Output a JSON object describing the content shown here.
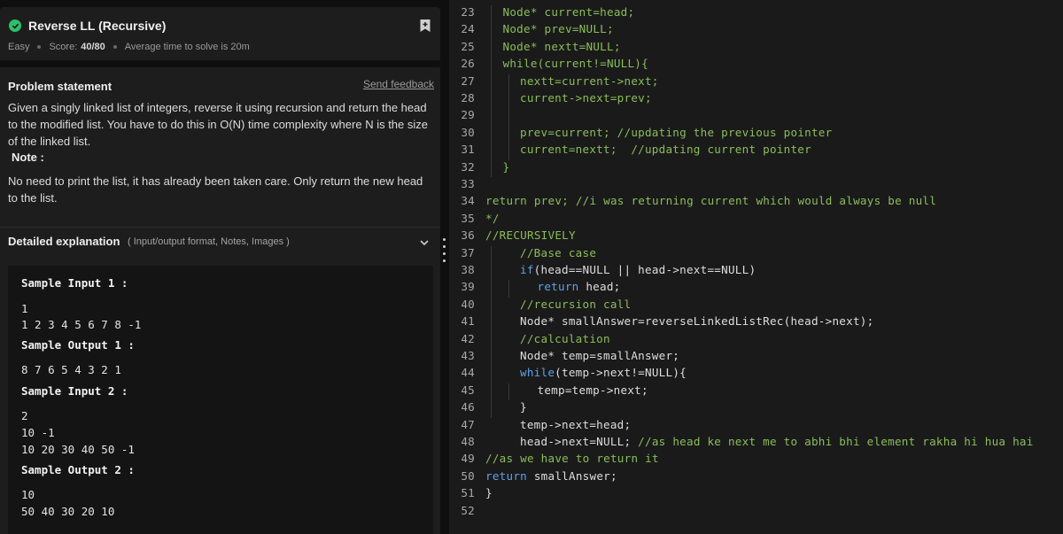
{
  "problem": {
    "title": "Reverse LL (Recursive)",
    "difficulty": "Easy",
    "score_label": "Score:",
    "score_value": "40/80",
    "avg_time": "Average time to solve is 20m"
  },
  "statement": {
    "heading": "Problem statement",
    "feedback_link": "Send feedback",
    "text": "Given a singly linked list of integers, reverse it using recursion and return the head to the modified list. You have to do this in O(N) time complexity where N is the size of the linked list.",
    "note_label": "Note :",
    "note_text": "No need to print the list, it has already been taken care. Only return the new head to the list."
  },
  "detail": {
    "title": "Detailed explanation",
    "subtitle": "( Input/output format, Notes, Images )"
  },
  "samples": {
    "input1_label": "Sample Input 1 :",
    "input1_lines": [
      "1",
      "1 2 3 4 5 6 7 8 -1"
    ],
    "output1_label": "Sample Output 1 :",
    "output1_lines": [
      "8 7 6 5 4 3 2 1"
    ],
    "input2_label": "Sample Input 2 :",
    "input2_lines": [
      "2",
      "10 -1",
      "10 20 30 40 50 -1"
    ],
    "output2_label": "Sample Output 2 :",
    "output2_lines": [
      "10",
      "50 40 30 20 10"
    ]
  },
  "colors": {
    "success": "#2ebd6b",
    "comment_green": "#8bbd5a",
    "keyword_blue": "#5fa0e8"
  },
  "icons": [
    "check-circle-icon",
    "bookmark-icon",
    "chevron-down-icon",
    "drag-handle-icon"
  ],
  "code_lines": [
    {
      "n": "23",
      "indent": 1,
      "tokens": [
        [
          "g",
          "Node* current=head;"
        ]
      ]
    },
    {
      "n": "24",
      "indent": 1,
      "tokens": [
        [
          "g",
          "Node* prev=NULL;"
        ]
      ]
    },
    {
      "n": "25",
      "indent": 1,
      "tokens": [
        [
          "g",
          "Node* nextt=NULL;"
        ]
      ]
    },
    {
      "n": "26",
      "indent": 1,
      "tokens": [
        [
          "g",
          "while(current!=NULL){"
        ]
      ]
    },
    {
      "n": "27",
      "indent": 2,
      "tokens": [
        [
          "g",
          "nextt=current->next;"
        ]
      ]
    },
    {
      "n": "28",
      "indent": 2,
      "tokens": [
        [
          "g",
          "current->next=prev;"
        ]
      ]
    },
    {
      "n": "29",
      "indent": 0,
      "tokens": []
    },
    {
      "n": "30",
      "indent": 2,
      "tokens": [
        [
          "g",
          "prev=current; //updating the previous pointer"
        ]
      ]
    },
    {
      "n": "31",
      "indent": 2,
      "tokens": [
        [
          "g",
          "current=nextt;  //updating current pointer"
        ]
      ]
    },
    {
      "n": "32",
      "indent": 1,
      "tokens": [
        [
          "g",
          "}"
        ]
      ]
    },
    {
      "n": "33",
      "indent": 0,
      "tokens": []
    },
    {
      "n": "34",
      "indent": 0,
      "tokens": [
        [
          "g",
          "return prev; //i was returning current which would always be null"
        ]
      ]
    },
    {
      "n": "35",
      "indent": 0,
      "tokens": [
        [
          "g",
          "*/"
        ]
      ]
    },
    {
      "n": "36",
      "indent": 0,
      "tokens": [
        [
          "g",
          "//RECURSIVELY"
        ]
      ]
    },
    {
      "n": "37",
      "indent": 2,
      "tokens": [
        [
          "g",
          "//Base case"
        ]
      ]
    },
    {
      "n": "38",
      "indent": 2,
      "tokens": [
        [
          "b",
          "if"
        ],
        [
          "w",
          "(head==NULL || head->next==NULL)"
        ]
      ]
    },
    {
      "n": "39",
      "indent": 3,
      "tokens": [
        [
          "b",
          "return"
        ],
        [
          "w",
          " head;"
        ]
      ]
    },
    {
      "n": "40",
      "indent": 2,
      "tokens": [
        [
          "g",
          "//recursion call"
        ]
      ]
    },
    {
      "n": "41",
      "indent": 2,
      "tokens": [
        [
          "w",
          "Node* smallAnswer=reverseLinkedListRec(head->next);"
        ]
      ]
    },
    {
      "n": "42",
      "indent": 2,
      "tokens": [
        [
          "g",
          "//calculation"
        ]
      ]
    },
    {
      "n": "43",
      "indent": 2,
      "tokens": [
        [
          "w",
          "Node* temp=smallAnswer;"
        ]
      ]
    },
    {
      "n": "44",
      "indent": 2,
      "tokens": [
        [
          "b",
          "while"
        ],
        [
          "w",
          "(temp->next!=NULL){"
        ]
      ]
    },
    {
      "n": "45",
      "indent": 3,
      "tokens": [
        [
          "w",
          "temp=temp->next;"
        ]
      ]
    },
    {
      "n": "46",
      "indent": 2,
      "tokens": [
        [
          "w",
          "}"
        ]
      ]
    },
    {
      "n": "47",
      "indent": 2,
      "tokens": [
        [
          "w",
          "temp->next=head;"
        ]
      ]
    },
    {
      "n": "48",
      "indent": 2,
      "tokens": [
        [
          "w",
          "head->next=NULL; "
        ],
        [
          "g",
          "//as head ke next me to abhi bhi element rakha hi hua hai"
        ]
      ]
    },
    {
      "n": "49",
      "indent": 0,
      "tokens": [
        [
          "g",
          "//as we have to return it"
        ]
      ]
    },
    {
      "n": "50",
      "indent": 0,
      "tokens": [
        [
          "b",
          "return"
        ],
        [
          "w",
          " smallAnswer;"
        ]
      ]
    },
    {
      "n": "51",
      "indent": 0,
      "tokens": [
        [
          "w",
          "}"
        ]
      ]
    },
    {
      "n": "52",
      "indent": 0,
      "tokens": []
    }
  ]
}
